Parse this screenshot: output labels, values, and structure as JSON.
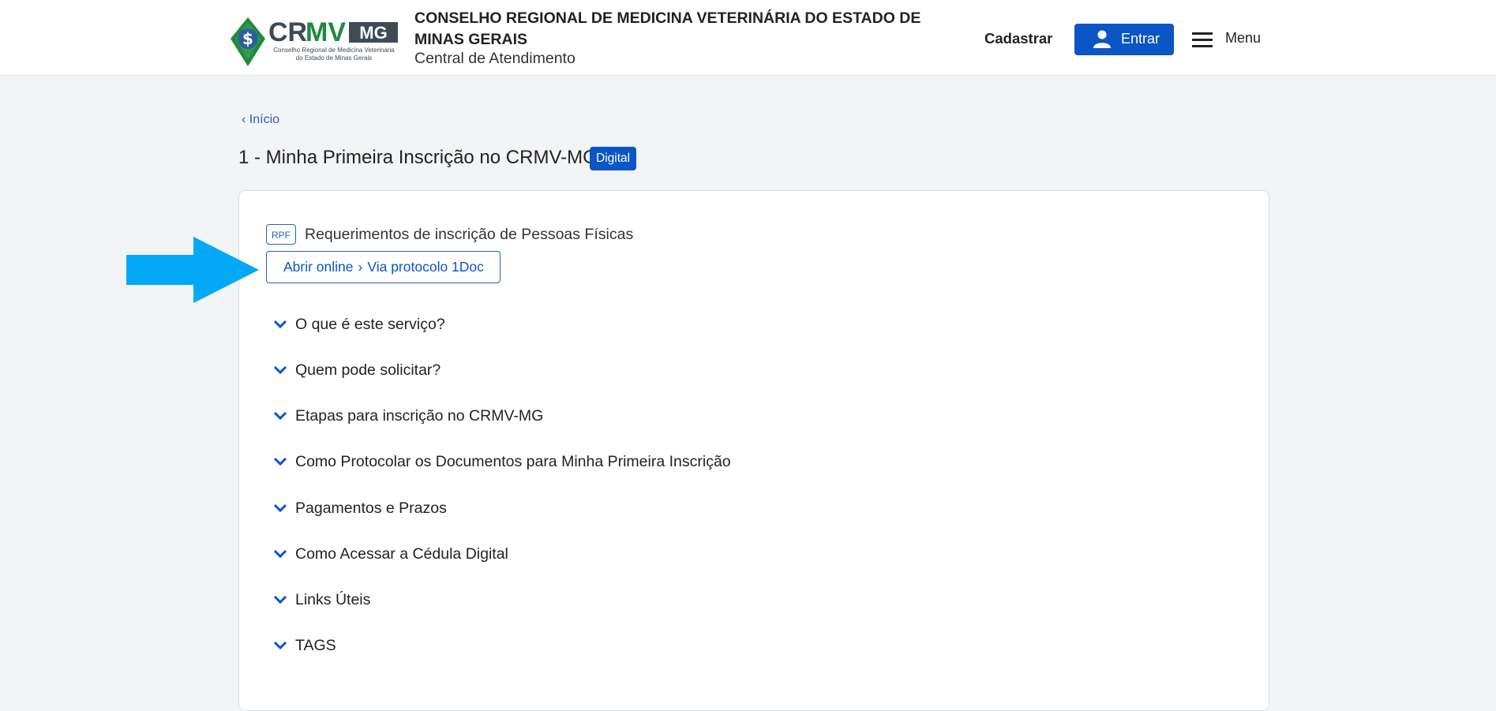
{
  "header": {
    "logo_text": "CRMV MG",
    "logo_subtext": "Conselho Regional de Medicina Veterinária do Estado de Minas Gerais",
    "org_name": "CONSELHO REGIONAL DE MEDICINA VETERINÁRIA DO ESTADO DE MINAS GERAIS",
    "org_sub": "Central de Atendimento",
    "register_label": "Cadastrar",
    "login_label": "Entrar",
    "menu_label": "Menu",
    "icons": {
      "login": "user-icon",
      "menu": "hamburger-icon"
    },
    "colors": {
      "primary": "#0b55c6",
      "logo_green": "#1e8a3c",
      "logo_dark": "#3f4a55"
    }
  },
  "breadcrumb": {
    "back_label": "‹ Início"
  },
  "page": {
    "title": "1 - Minha Primeira Inscrição no CRMV-MG",
    "badge": "Digital"
  },
  "service": {
    "tag": "RPF",
    "title": "Requerimentos de inscrição de Pessoas Físicas",
    "open_online_label": "Abrir online",
    "open_online_sep": "›",
    "open_online_via": "Via protocolo 1Doc"
  },
  "annotation": {
    "arrow_color": "#03a9f4",
    "icon": "arrow-right-icon"
  },
  "accordion": [
    {
      "label": "O que é este serviço?"
    },
    {
      "label": "Quem pode solicitar?"
    },
    {
      "label": "Etapas para inscrição no CRMV-MG"
    },
    {
      "label": "Como Protocolar os Documentos para Minha Primeira Inscrição"
    },
    {
      "label": "Pagamentos e Prazos"
    },
    {
      "label": "Como Acessar a Cédula Digital"
    },
    {
      "label": "Links Úteis"
    },
    {
      "label": "TAGS"
    }
  ]
}
